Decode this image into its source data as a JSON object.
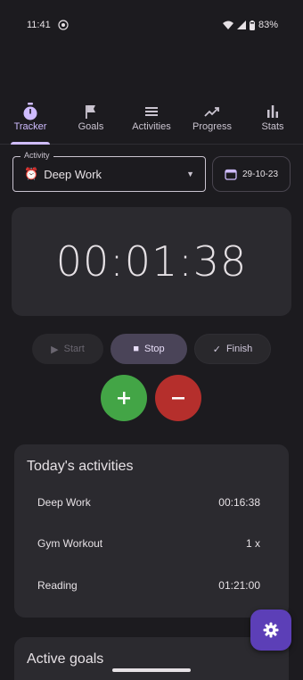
{
  "status_bar": {
    "time": "11:41",
    "battery": "83%"
  },
  "tabs": [
    {
      "label": "Tracker",
      "icon": "stopwatch-icon",
      "active": true
    },
    {
      "label": "Goals",
      "icon": "flag-icon",
      "active": false
    },
    {
      "label": "Activities",
      "icon": "list-icon",
      "active": false
    },
    {
      "label": "Progress",
      "icon": "trending-icon",
      "active": false
    },
    {
      "label": "Stats",
      "icon": "bar-chart-icon",
      "active": false
    }
  ],
  "activity_field": {
    "legend": "Activity",
    "value": "Deep Work",
    "emoji": "⏰"
  },
  "date_chip": {
    "label": "29-10-23",
    "icon": "calendar-icon"
  },
  "timer": {
    "value": "00:01:38"
  },
  "controls": {
    "start": "Start",
    "stop": "Stop",
    "finish": "Finish"
  },
  "today": {
    "title": "Today's activities",
    "rows": [
      {
        "name": "Deep Work",
        "value": "00:16:38"
      },
      {
        "name": "Gym Workout",
        "value": "1 x"
      },
      {
        "name": "Reading",
        "value": "01:21:00"
      }
    ]
  },
  "goals": {
    "title": "Active goals"
  },
  "colors": {
    "background": "#1c1b1f",
    "accent": "#cfbcff",
    "plus_button": "#43a546",
    "minus_button": "#b52f2c",
    "fab": "#5c3fb7"
  },
  "fab": {
    "icon": "gear-icon"
  }
}
